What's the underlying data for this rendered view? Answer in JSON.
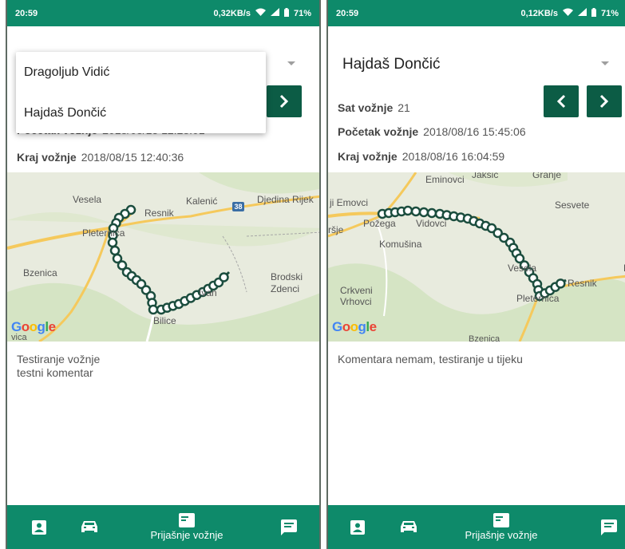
{
  "left": {
    "status": {
      "time": "20:59",
      "speed": "0,32KB/s",
      "battery": "71%"
    },
    "dropdown_options": [
      "Dragoljub Vidić",
      "Hajdaš Dončić"
    ],
    "info": {
      "start_label": "Početak vožnje",
      "start_value": "2018/08/15 12:28:01",
      "end_label": "Kraj vožnje",
      "end_value": "2018/08/15 12:40:36"
    },
    "map": {
      "places": [
        "Vesela",
        "Resnik",
        "Kalenić",
        "Djedina Rijek",
        "Pleternica",
        "Bzenica",
        "Brodski",
        "Zdenci",
        "Bilice",
        "Ivan",
        "vica"
      ],
      "road_number": "38",
      "google": [
        "G",
        "o",
        "o",
        "g",
        "l",
        "e"
      ]
    },
    "comment_lines": [
      "Testiranje vožnje",
      "testni komentar"
    ],
    "bottom_nav": {
      "rides_label": "Prijašnje vožnje"
    }
  },
  "right": {
    "status": {
      "time": "20:59",
      "speed": "0,12KB/s",
      "battery": "71%"
    },
    "spinner_value": "Hajdaš Dončić",
    "info": {
      "sat_label": "Sat vožnje",
      "sat_value": "21",
      "start_label": "Početak vožnje",
      "start_value": "2018/08/16 15:45:06",
      "end_label": "Kraj vožnje",
      "end_value": "2018/08/16 16:04:59"
    },
    "map": {
      "places": [
        "Eminovci",
        "Jakšić",
        "Granje",
        "ji Emovci",
        "Sesvete",
        "Požega",
        "Vidovci",
        "ršje",
        "Komušina",
        "Vesela",
        "Resnik",
        "K",
        "Crkveni",
        "Vrhovci",
        "Pleternica",
        "Bzenica"
      ],
      "google": [
        "G",
        "o",
        "o",
        "g",
        "l",
        "e"
      ]
    },
    "comment": "Komentara nemam, testiranje u tijeku",
    "bottom_nav": {
      "rides_label": "Prijašnje vožnje"
    }
  },
  "colors": {
    "primary": "#0e8a6a",
    "dark_button": "#0c5c45",
    "track": "#1b4d3e"
  },
  "icons": [
    "wifi-icon",
    "signal-icon",
    "battery-icon",
    "chevron-left-icon",
    "chevron-right-icon",
    "person-card-icon",
    "car-icon",
    "ride-card-icon",
    "message-icon"
  ]
}
